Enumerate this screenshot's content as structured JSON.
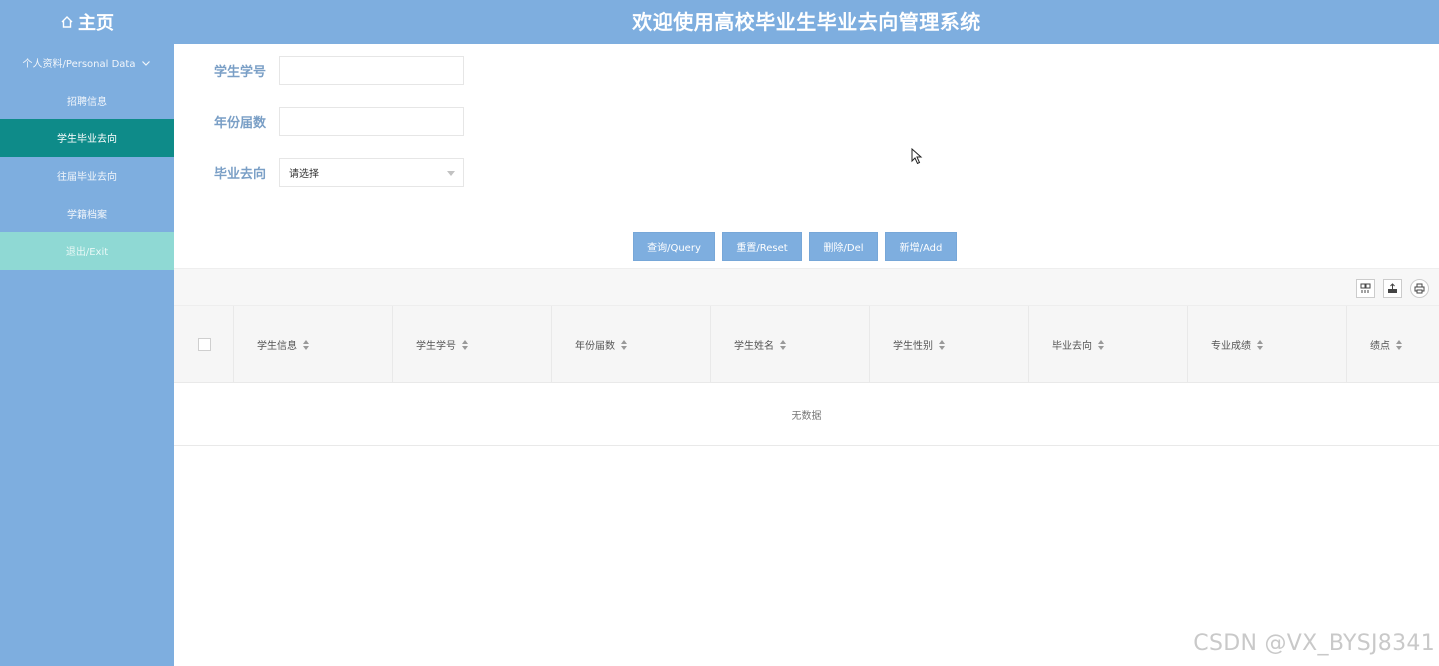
{
  "header": {
    "home_label": "主页",
    "title": "欢迎使用高校毕业生毕业去向管理系统"
  },
  "sidebar": {
    "items": [
      {
        "label": "个人资料/Personal Data"
      },
      {
        "label": "招聘信息"
      },
      {
        "label": "学生毕业去向"
      },
      {
        "label": "往届毕业去向"
      },
      {
        "label": "学籍档案"
      },
      {
        "label": "退出/Exit"
      }
    ],
    "active_index": 2
  },
  "form": {
    "student_id_label": "学生学号",
    "student_id_value": "",
    "year_label": "年份届数",
    "year_value": "",
    "destination_label": "毕业去向",
    "destination_selected": "请选择"
  },
  "buttons": {
    "query": "查询/Query",
    "reset": "重置/Reset",
    "delete": "删除/Del",
    "add": "新增/Add"
  },
  "toolbar": {
    "icons": [
      "columns-icon",
      "export-icon",
      "print-icon"
    ]
  },
  "table": {
    "columns": [
      "学生信息",
      "学生学号",
      "年份届数",
      "学生姓名",
      "学生性别",
      "毕业去向",
      "专业成绩",
      "绩点"
    ],
    "empty_text": "无数据"
  },
  "watermark": "CSDN @VX_BYSJ8341",
  "colors": {
    "header_blue": "#7eaedf",
    "active_teal": "#0e8b89",
    "exit_mint": "#8fd9d4",
    "label_blue": "#7a9fc6"
  }
}
